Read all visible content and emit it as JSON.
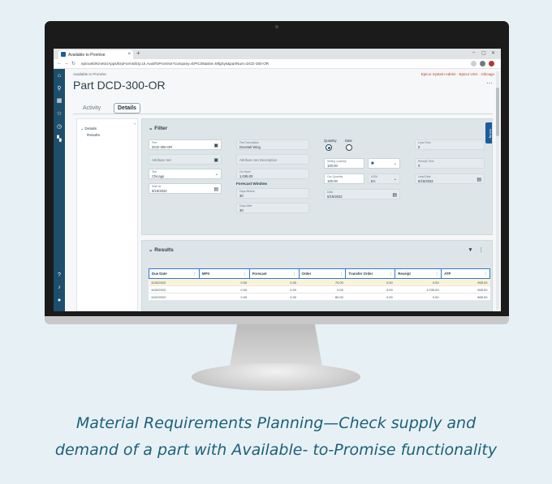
{
  "browser": {
    "tab_title": "Available to Promise",
    "close_glyph": "×",
    "new_tab_glyph": "+",
    "url": "epicweb/Kinetic/Apps/ErpForms/Erp.UI.AvailToPromise?company=EPIC06&site=MfgSys&partNum=DCD-300-OR",
    "window_controls": [
      "–",
      "▢",
      "✕"
    ]
  },
  "app": {
    "breadcrumb": "Available to Promise",
    "user_links": "Epicor System Admin · Epicor USA · Chicago",
    "page_title": "Part DCD-300-OR",
    "more_glyph": "⋯",
    "tabs": [
      {
        "label": "Activity",
        "active": false
      },
      {
        "label": "Details",
        "active": true
      }
    ]
  },
  "tree": {
    "collapse_glyph": "«",
    "items": [
      {
        "label": "Details",
        "expanded": true
      },
      {
        "label": "Results"
      }
    ]
  },
  "filter": {
    "title": "Filter",
    "side_button": "Activity",
    "part": {
      "label": "Part",
      "value": "DCD-300-OR"
    },
    "attribute_set": {
      "placeholder": "Attribute Set"
    },
    "site": {
      "label": "Site",
      "value": "Chicago"
    },
    "start_at": {
      "label": "Start At",
      "value": "6/15/2022"
    },
    "part_description": {
      "label": "Part Description",
      "value": "Dovetail Wing"
    },
    "attribute_set_description": {
      "placeholder": "Attribute Set Description"
    },
    "on_hand": {
      "label": "On Hand",
      "value": "1,035.00"
    },
    "forecast_window": {
      "heading": "Forecast Window",
      "days_before": {
        "label": "Days Before",
        "value": "30"
      },
      "days_after": {
        "label": "Days After",
        "value": "30"
      }
    },
    "radio": {
      "quantity": "Quantity",
      "date": "Date",
      "selected": "quantity"
    },
    "selling_quantity": {
      "label": "Selling Quantity",
      "value": "100.00"
    },
    "our_quantity": {
      "label": "Our Quantity",
      "value": "100.00"
    },
    "uom": {
      "label": "UOM",
      "value": "EA"
    },
    "date": {
      "label": "Date",
      "value": "6/15/2022"
    },
    "lead_time": {
      "label": "Lead Time",
      "value": "0"
    },
    "receipt_time": {
      "label": "Receipt Time",
      "value": "0"
    },
    "lead_date": {
      "label": "Lead Date",
      "value": "6/15/2022"
    }
  },
  "results": {
    "title": "Results",
    "filter_glyph": "▼",
    "menu_glyph": "⋮",
    "columns": [
      "Due Date",
      "MPS",
      "Forecast",
      "Order",
      "Transfer Order",
      "Receipt",
      "ATP"
    ],
    "rows": [
      [
        "6/15/2022",
        "0.00",
        "0.00",
        "70.00",
        "0.00",
        "0.00",
        "965.00"
      ],
      [
        "6/15/2022",
        "0.00",
        "0.00",
        "0.00",
        "0.00",
        "1,035.00",
        "965.00"
      ],
      [
        "6/22/2022",
        "0.00",
        "0.00",
        "80.00",
        "0.00",
        "0.00",
        "885.00"
      ]
    ]
  },
  "caption": {
    "line1": "Material Requirements Planning—Check supply and",
    "line2": "demand of a part with Available- to-Promise functionality"
  }
}
